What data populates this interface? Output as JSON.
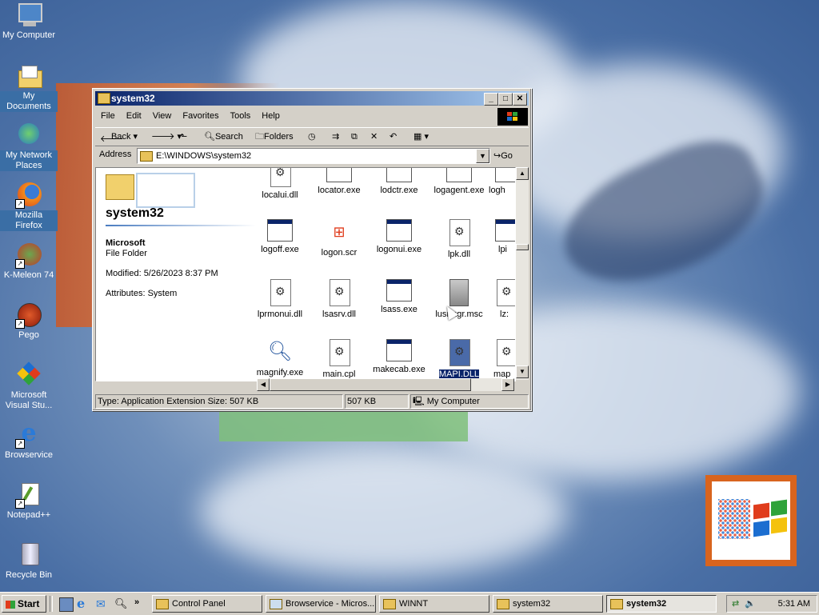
{
  "desktop": {
    "icons": [
      {
        "label": "My Computer",
        "icon": "my-computer-icon"
      },
      {
        "label": "My Documents",
        "icon": "my-documents-icon"
      },
      {
        "label": "My Network Places",
        "icon": "network-places-icon"
      },
      {
        "label": "Mozilla Firefox",
        "icon": "firefox-icon"
      },
      {
        "label": "K-Meleon 74",
        "icon": "kmeleon-icon"
      },
      {
        "label": "Pego",
        "icon": "pego-icon"
      },
      {
        "label": "Microsoft Visual Stu...",
        "icon": "visual-studio-icon"
      },
      {
        "label": "Browservice",
        "icon": "ie-icon"
      },
      {
        "label": "Notepad++",
        "icon": "notepadpp-icon"
      },
      {
        "label": "Recycle Bin",
        "icon": "recycle-bin-icon"
      }
    ]
  },
  "window": {
    "title": "system32",
    "menu": [
      "File",
      "Edit",
      "View",
      "Favorites",
      "Tools",
      "Help"
    ],
    "toolbar": {
      "back": "Back",
      "search": "Search",
      "folders": "Folders"
    },
    "address": {
      "label": "Address",
      "value": "E:\\WINDOWS\\system32",
      "go": "Go"
    },
    "left_pane": {
      "title": "system32",
      "name": "Microsoft",
      "type": "File Folder",
      "modified": "Modified: 5/26/2023 8:37 PM",
      "attributes": "Attributes: System"
    },
    "files": {
      "row1": [
        "localui.dll",
        "locator.exe",
        "lodctr.exe",
        "logagent.exe",
        "logh"
      ],
      "row2": [
        "logoff.exe",
        "logon.scr",
        "logonui.exe",
        "lpk.dll",
        "lpi"
      ],
      "row3": [
        "lprmonui.dll",
        "lsasrv.dll",
        "lsass.exe",
        "lusrmgr.msc",
        "lz:"
      ],
      "row4": [
        "magnify.exe",
        "main.cpl",
        "makecab.exe",
        "MAPI.DLL",
        "map"
      ]
    },
    "selected_file": "MAPI.DLL",
    "status": {
      "info": "Type: Application Extension Size: 507 KB",
      "size": "507 KB",
      "zone": "My Computer"
    }
  },
  "taskbar": {
    "start": "Start",
    "tasks": [
      "Control Panel",
      "Browservice - Micros...",
      "WINNT",
      "system32",
      "system32"
    ],
    "clock": "5:31 AM"
  },
  "colors": {
    "titlebar": "#0a246a",
    "desktop": "#3a6ea5",
    "selection": "#0a246a"
  }
}
